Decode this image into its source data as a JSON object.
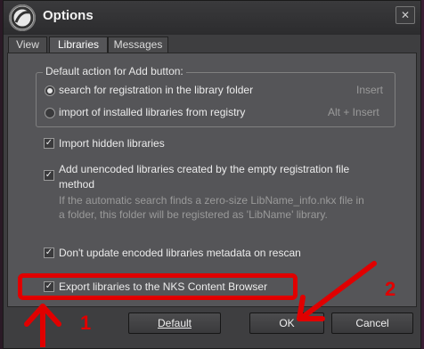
{
  "dialog": {
    "title": "Options",
    "close_glyph": "✕"
  },
  "tabs": [
    {
      "label": "View"
    },
    {
      "label": "Libraries"
    },
    {
      "label": "Messages"
    }
  ],
  "default_action": {
    "group_label": "Default action for Add button:",
    "options": [
      {
        "label": "search for registration in the library folder",
        "shortcut": "Insert",
        "selected": true
      },
      {
        "label": "import of installed libraries from registry",
        "shortcut": "Alt + Insert",
        "selected": false
      }
    ]
  },
  "checkboxes": {
    "import_hidden": {
      "label": "Import hidden libraries",
      "checked": true
    },
    "add_unencoded": {
      "label_line1": "Add unencoded libraries created by the empty registration file",
      "label_line2": "method",
      "hint_line1": "If the automatic search finds a zero-size LibName_info.nkx file in",
      "hint_line2": "a folder, this folder will be registered as 'LibName' library.",
      "checked": true
    },
    "dont_update": {
      "label": "Don't update encoded libraries metadata on rescan",
      "checked": true
    },
    "export_nks": {
      "label": "Export libraries to the NKS Content Browser",
      "checked": true
    }
  },
  "buttons": {
    "default_label": "Default",
    "ok_label": "OK",
    "cancel_label": "Cancel"
  },
  "annotations": {
    "step1": "1",
    "step2": "2",
    "color": "#e00000"
  }
}
